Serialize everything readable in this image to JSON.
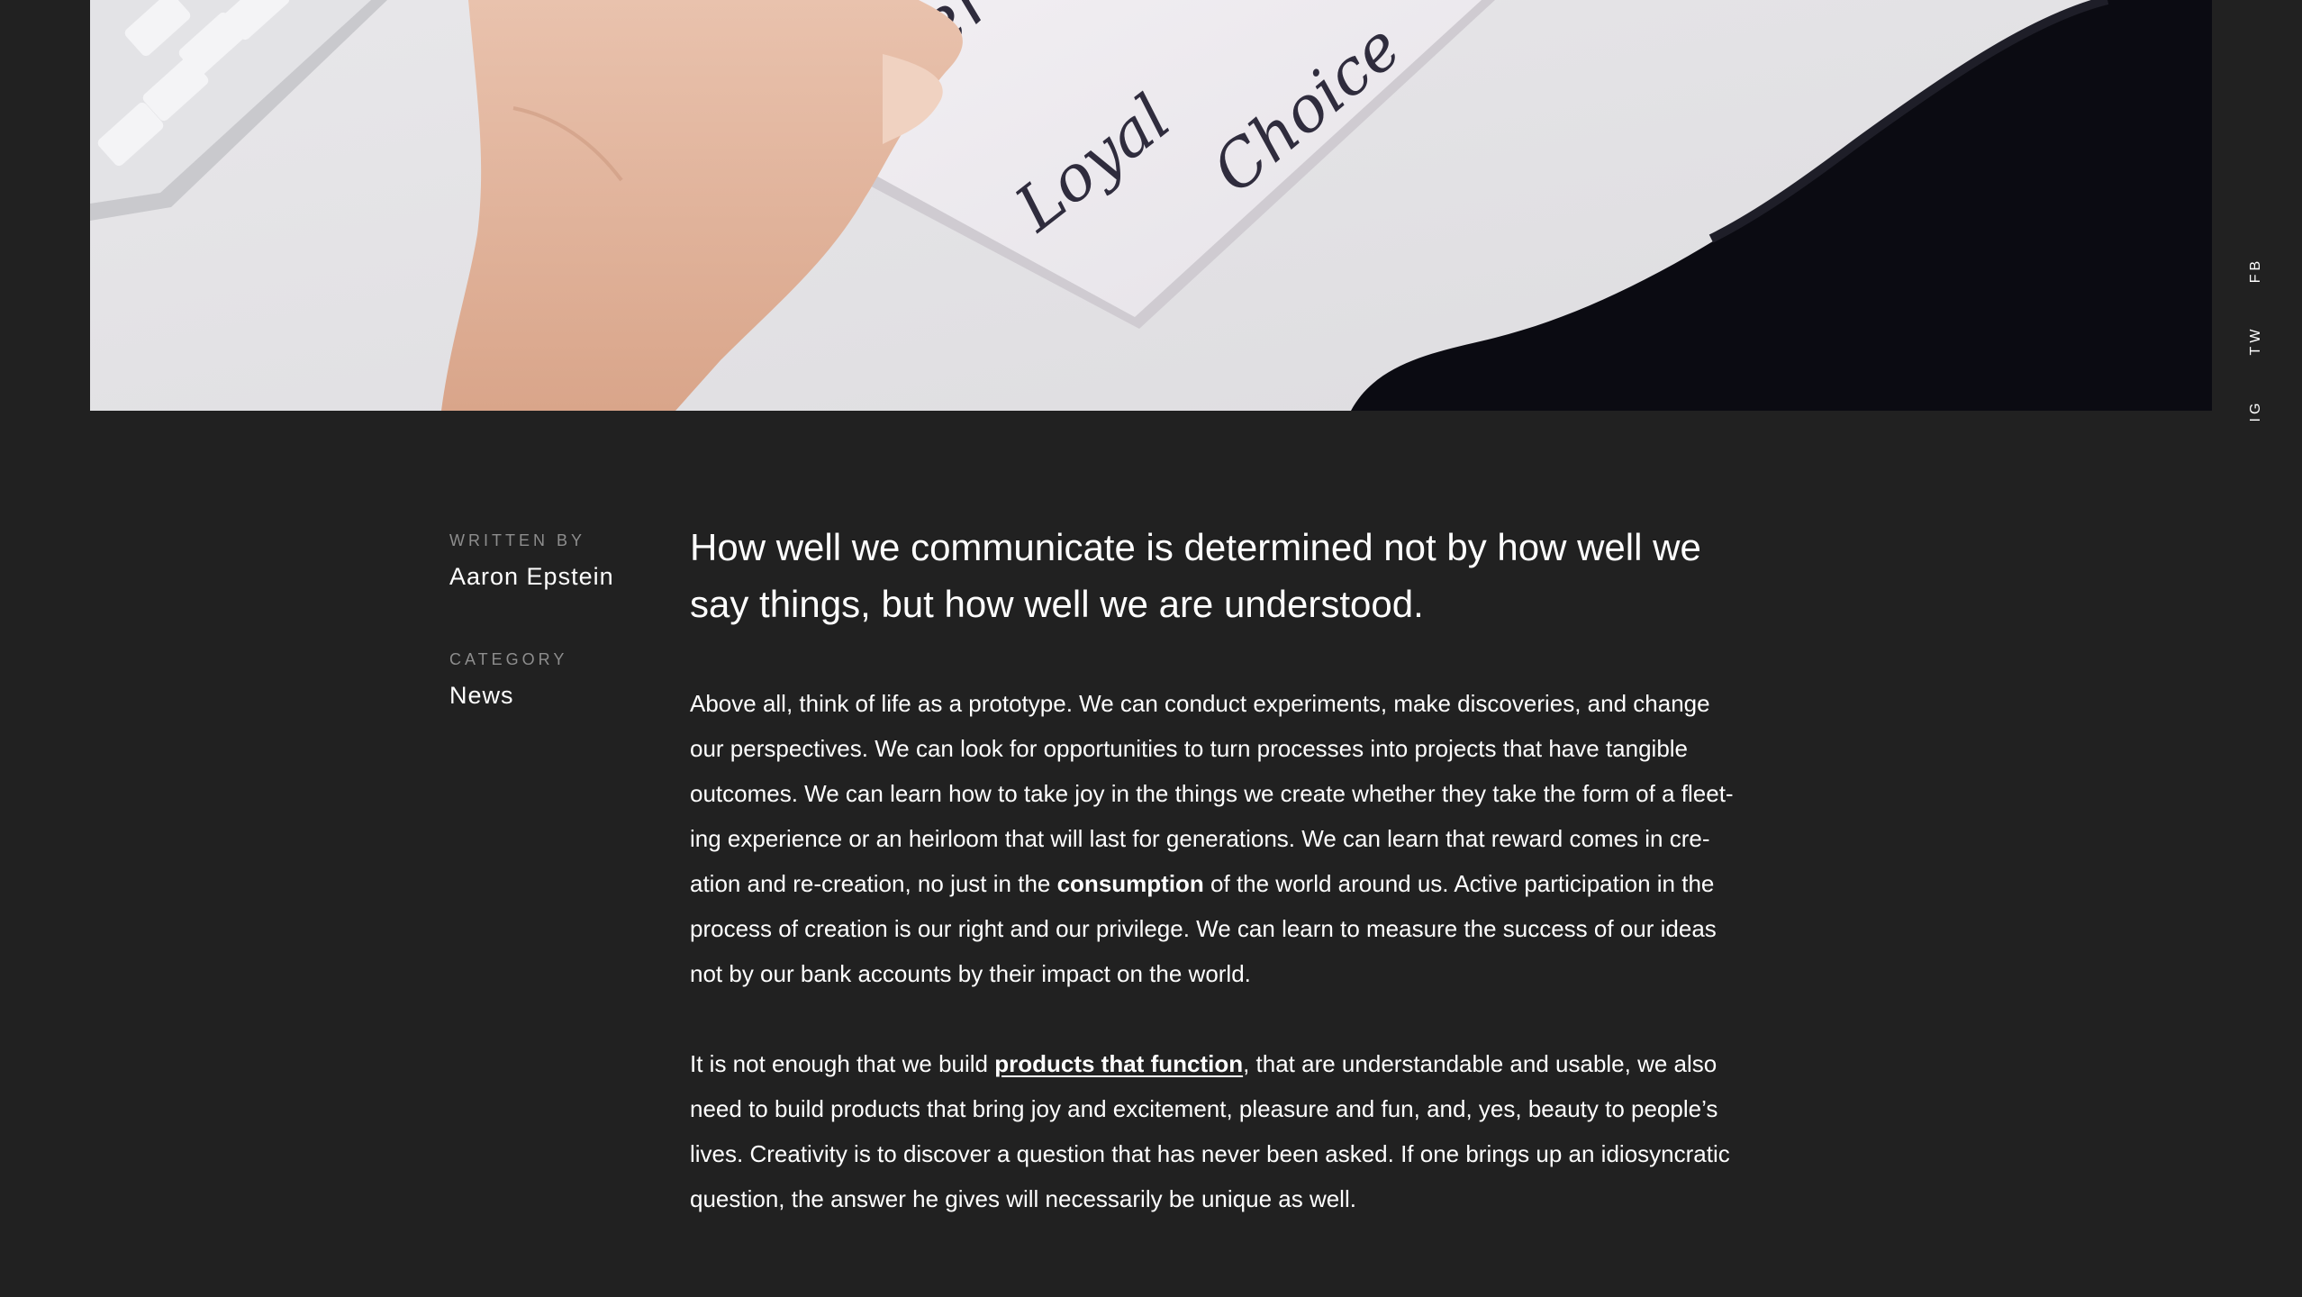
{
  "social": {
    "items": [
      {
        "label": "FB"
      },
      {
        "label": "TW"
      },
      {
        "label": "IG"
      }
    ]
  },
  "hero": {
    "words": [
      "Ever",
      "Loyal",
      "Choice"
    ]
  },
  "meta": {
    "written_by_label": "WRITTEN BY",
    "author": "Aaron Epstein",
    "category_label": "CATEGORY",
    "category": "News"
  },
  "article": {
    "headline": "How well we communicate is determined not by how well we say things, but how well we are understood.",
    "p1_part1": "Above all, think of life as a prototype. We can conduct experiments, make discoveries, and change our perspectives. We can look for opportunities to turn processes into projects that have tangible outcomes. We can learn how to take joy in the things we create whether they take the form of a fleet-ing experience or an heirloom that will last for generations. We can learn that reward comes in cre-ation and re-creation, no just in the ",
    "p1_bold": "consumption",
    "p1_part2": " of the world around us. Active participation in the process of creation is our right and our privilege. We can learn to measure the success of our ideas not by our bank accounts by their impact on the world.",
    "p2_part1": "It is not enough that we build ",
    "p2_link": "products that function",
    "p2_part2": ", that are understandable and usable, we also need to build products that bring joy and excitement, pleasure and fun, and, yes, beauty to people’s lives. Creativity is to discover a question that has never been asked. If one brings up an idiosyncratic question, the answer he gives will necessarily be unique as well."
  },
  "colors": {
    "background": "#212121",
    "text": "#ffffff",
    "muted": "#8e8e8e"
  }
}
